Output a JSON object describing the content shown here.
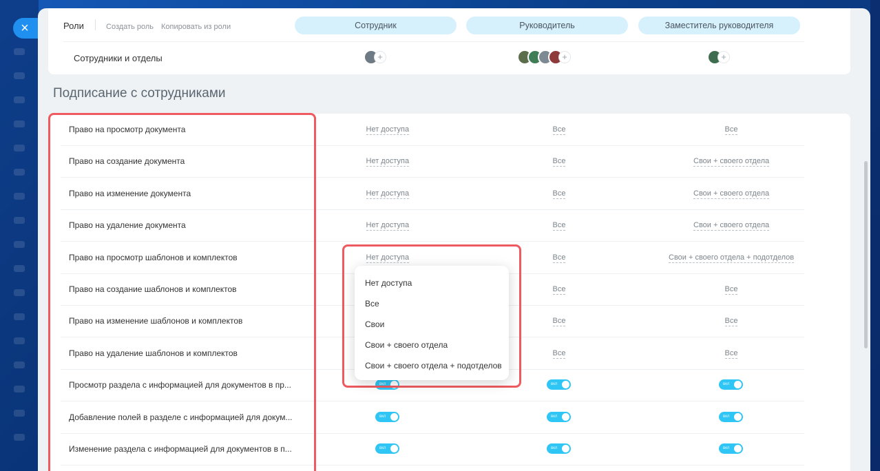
{
  "colors": {
    "accent": "#2fc6f6",
    "pill": "#d6f1fc",
    "highlight": "#ee5a5f",
    "close_button": "#1f8ff0"
  },
  "close_button": {
    "icon": "close-icon",
    "label": "×"
  },
  "roles": {
    "title": "Роли",
    "create_link": "Создать роль",
    "copy_link": "Копировать из роли",
    "columns": [
      "Сотрудник",
      "Руководитель",
      "Заместитель руководителя"
    ]
  },
  "employees": {
    "label": "Сотрудники и отделы",
    "add_label": "+"
  },
  "section": {
    "title": "Подписание с сотрудниками"
  },
  "toggle_label": "вкл",
  "permissions": [
    {
      "name": "Право на просмотр документа",
      "values": [
        "Нет доступа",
        "Все",
        "Все"
      ]
    },
    {
      "name": "Право на создание документа",
      "values": [
        "Нет доступа",
        "Все",
        "Свои + своего отдела"
      ]
    },
    {
      "name": "Право на изменение документа",
      "values": [
        "Нет доступа",
        "Все",
        "Свои + своего отдела"
      ]
    },
    {
      "name": "Право на удаление документа",
      "values": [
        "Нет доступа",
        "Все",
        "Свои + своего отдела"
      ]
    },
    {
      "name": "Право на просмотр шаблонов и комплектов",
      "values": [
        "Нет доступа",
        "Все",
        "Свои + своего отдела + подотделов"
      ]
    },
    {
      "name": "Право на создание шаблонов и комплектов",
      "values": [
        "",
        "Все",
        "Все"
      ]
    },
    {
      "name": "Право на изменение шаблонов и комплектов",
      "values": [
        "",
        "Все",
        "Все"
      ]
    },
    {
      "name": "Право на удаление шаблонов и комплектов",
      "values": [
        "",
        "Все",
        "Все"
      ]
    },
    {
      "name": "Просмотр раздела с информацией для документов в пр...",
      "toggles": [
        true,
        true,
        true
      ]
    },
    {
      "name": "Добавление полей в разделе с информацией для докум...",
      "toggles": [
        true,
        true,
        true
      ]
    },
    {
      "name": "Изменение раздела с информацией для документов в п...",
      "toggles": [
        true,
        true,
        true
      ]
    }
  ],
  "dropdown": {
    "options": [
      "Нет доступа",
      "Все",
      "Свои",
      "Свои + своего отдела",
      "Свои + своего отдела + подотделов"
    ]
  }
}
